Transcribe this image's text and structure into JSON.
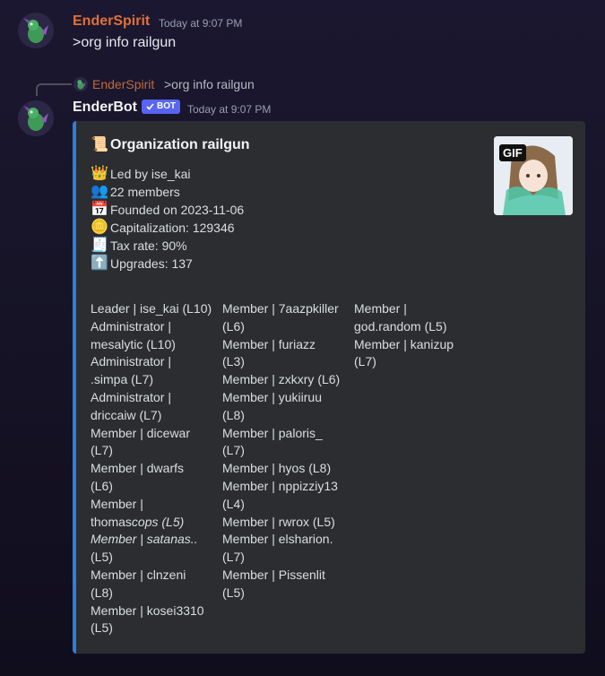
{
  "message1": {
    "author": "EnderSpirit",
    "timestamp": "Today at 9:07 PM",
    "text": ">org info railgun",
    "name_color": "#e0703a"
  },
  "reply": {
    "author": "EnderSpirit",
    "text": ">org info railgun"
  },
  "message2": {
    "author": "EnderBot",
    "badge": "BOT",
    "timestamp": "Today at 9:07 PM"
  },
  "embed": {
    "accent_color": "#2d7fd8",
    "title": "Organization railgun",
    "title_icon": "scroll-icon",
    "thumbnail_badge": "GIF",
    "stats": [
      {
        "icon": "crown-icon",
        "text": "Led by ise_kai"
      },
      {
        "icon": "people-icon",
        "text": "22 members"
      },
      {
        "icon": "calendar-icon",
        "text": "Founded on 2023-11-06"
      },
      {
        "icon": "coin-icon",
        "text": "Capitalization: 129346"
      },
      {
        "icon": "receipt-icon",
        "text": "Tax rate: 90%"
      },
      {
        "icon": "arrow-up-icon",
        "text": "Upgrades: 137"
      }
    ],
    "columns": [
      [
        "Leader | ise_kai (L10)",
        "Administrator |",
        "mesalytic (L10)",
        "Administrator |",
        ".simpa (L7)",
        "Administrator |",
        "driccaiw (L7)",
        "Member | dicewar",
        "(L7)",
        "Member | dwarfs",
        "(L6)",
        "Member |",
        "thomas",
        "cops (L5)",
        "Member | satanas..",
        "(L5)",
        "Member | clnzeni",
        "(L8)",
        "Member | kosei3310",
        "(L5)"
      ],
      [
        "Member | 7aazpkiller",
        "(L6)",
        "Member | furiazz",
        "(L3)",
        "Member | zxkxry (L6)",
        "Member | yukiiruu",
        "(L8)",
        "Member | paloris_",
        "(L7)",
        "Member | hyos (L8)",
        "Member | nppizziy13",
        "(L4)",
        "Member | rwrox (L5)",
        "Member | elsharion.",
        "(L7)",
        "Member | Pissenlit",
        "(L5)"
      ],
      [
        "Member |",
        "god.random (L5)",
        "Member | kanizup",
        "(L7)"
      ]
    ]
  }
}
